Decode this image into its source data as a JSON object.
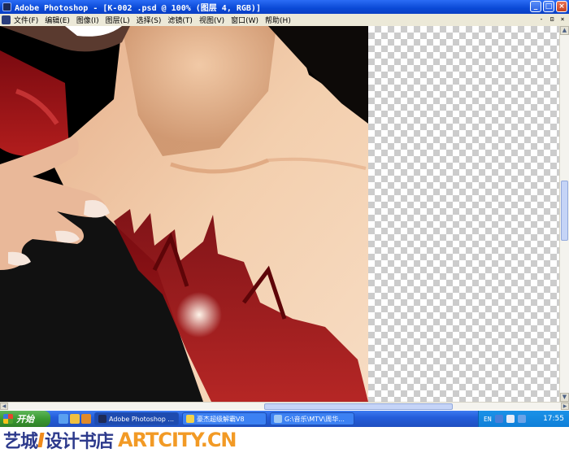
{
  "window": {
    "title": "Adobe Photoshop - [K-002 .psd @ 100% (图层 4, RGB)]",
    "buttons": {
      "minimize": "_",
      "maximize": "□",
      "close": "×"
    }
  },
  "menu": {
    "items": [
      "文件(F)",
      "编辑(E)",
      "图像(I)",
      "图层(L)",
      "选择(S)",
      "滤镜(T)",
      "视图(V)",
      "窗口(W)",
      "帮助(H)"
    ],
    "doc_buttons": {
      "minimize": "-",
      "restore": "⊡",
      "close": "×"
    }
  },
  "canvas": {
    "artwork": "painted portrait: neck, collarbone and hand with red flame tattoo",
    "transparent_region": true
  },
  "taskbar": {
    "start_label": "开始",
    "tasks": [
      "Adobe Photoshop ...",
      "豪杰超级解霸V8",
      "G:\\音乐\\MTV\\周华..."
    ],
    "tray_lang": "EN",
    "clock": "17:55"
  },
  "watermark": {
    "cn_part1": "艺城",
    "cn_part2": "设计书店",
    "en": "ARTCITY.CN"
  },
  "colors": {
    "titlebar": "#0a49d6",
    "menubar": "#ece9d8",
    "taskbar": "#245edb",
    "start": "#3a9a32",
    "watermark_blue": "#2d3a8c",
    "watermark_orange": "#f29a25"
  }
}
